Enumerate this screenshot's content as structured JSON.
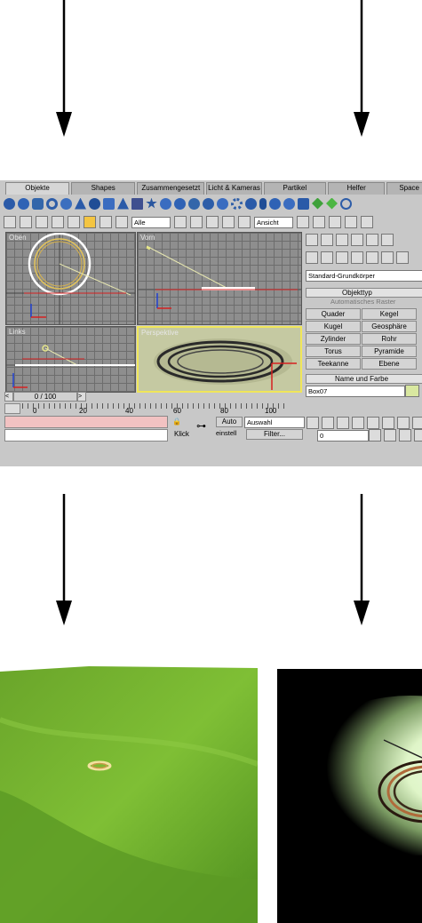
{
  "tabs": [
    "Objekte",
    "Shapes",
    "Zusammengesetzt",
    "Licht & Kameras",
    "Partikel",
    "Helfer",
    "Space"
  ],
  "toolbar": {
    "filter_value": "Alle",
    "view_value": "Ansicht"
  },
  "viewports": {
    "top": "Oben",
    "front": "Vorn",
    "left": "Links",
    "perspective": "Perspektive"
  },
  "panel": {
    "category_value": "Standard-Grundkörper",
    "rollout_object_type": "Objekttyp",
    "auto_grid_label": "Automatisches Raster",
    "buttons": [
      "Quader",
      "Kegel",
      "Kugel",
      "Geosphäre",
      "Zylinder",
      "Rohr",
      "Torus",
      "Pyramide",
      "Teekanne",
      "Ebene"
    ],
    "rollout_name_color": "Name und Farbe",
    "name_value": "Box07"
  },
  "timeline": {
    "frame_label": "0 / 100",
    "ticks": [
      "0",
      "20",
      "40",
      "60",
      "80",
      "100"
    ]
  },
  "bottom": {
    "click_text": "Klick",
    "auto_label": "Auto",
    "set_label": "einstell",
    "selection_value": "Auswahl",
    "filter_label": "Filter...",
    "frame_value": "0"
  },
  "colors": {
    "object_color_swatch": "#d9e8a0",
    "grass": "#6fb02a",
    "night": "#000000"
  }
}
